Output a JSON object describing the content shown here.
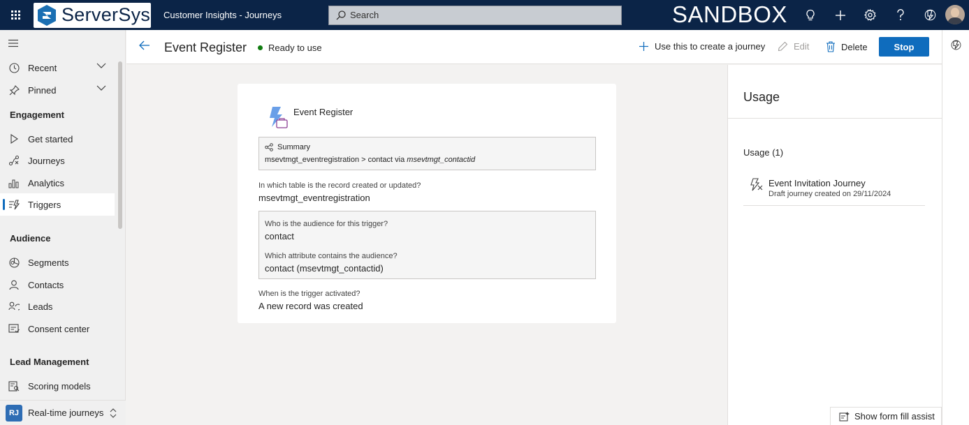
{
  "topbar": {
    "brand": "ServerSys",
    "app_title": "Customer Insights - Journeys",
    "search_placeholder": "Search",
    "environment": "SANDBOX"
  },
  "sidebar": {
    "items_top": [
      {
        "label": "Recent",
        "icon": "clock-icon"
      },
      {
        "label": "Pinned",
        "icon": "pin-icon"
      }
    ],
    "groups": {
      "engagement": "Engagement",
      "audience": "Audience",
      "lead_management": "Lead Management"
    },
    "engagement_items": [
      {
        "label": "Get started",
        "icon": "play-icon"
      },
      {
        "label": "Journeys",
        "icon": "journeys-icon"
      },
      {
        "label": "Analytics",
        "icon": "analytics-icon"
      },
      {
        "label": "Triggers",
        "icon": "triggers-icon"
      }
    ],
    "audience_items": [
      {
        "label": "Segments",
        "icon": "segments-icon"
      },
      {
        "label": "Contacts",
        "icon": "person-icon"
      },
      {
        "label": "Leads",
        "icon": "leads-icon"
      },
      {
        "label": "Consent center",
        "icon": "consent-icon"
      }
    ],
    "lead_items": [
      {
        "label": "Scoring models",
        "icon": "scoring-icon"
      }
    ],
    "area": {
      "badge": "RJ",
      "label": "Real-time journeys"
    }
  },
  "command_bar": {
    "title": "Event Register",
    "status": "Ready to use",
    "use_journey": "Use this to create a journey",
    "edit": "Edit",
    "delete": "Delete",
    "stop": "Stop"
  },
  "card": {
    "title": "Event Register",
    "summary_label": "Summary",
    "summary_text": "msevtmgt_eventregistration > contact via",
    "summary_attr": "msevtmgt_contactid",
    "table_label": "In which table is the record created or updated?",
    "table_value": "msevtmgt_eventregistration",
    "audience_label": "Who is the audience for this trigger?",
    "audience_value": "contact",
    "attribute_label": "Which attribute contains the audience?",
    "attribute_value": "contact (msevtmgt_contactid)",
    "activated_label": "When is the trigger activated?",
    "activated_value": "A new record was created"
  },
  "usage": {
    "title": "Usage",
    "count_label": "Usage (1)",
    "items": [
      {
        "name": "Event Invitation Journey",
        "detail": "Draft journey created on 29/11/2024"
      }
    ]
  },
  "form_assist": "Show form fill assist",
  "colors": {
    "topbar": "#0b2447",
    "accent": "#0f6cbd",
    "status_ready": "#107c10"
  }
}
